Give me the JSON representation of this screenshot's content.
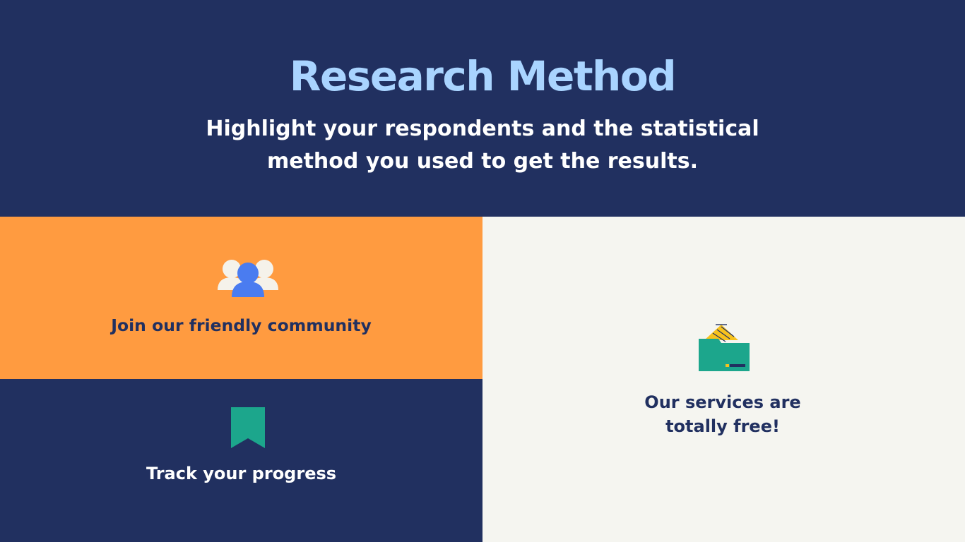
{
  "header": {
    "title": "Research Method",
    "subtitle": "Highlight your respondents and the statistical method you used to get the results."
  },
  "features": [
    {
      "label": "Join our friendly community",
      "icon": "users-icon"
    },
    {
      "label": "Track your progress",
      "icon": "bookmark-icon"
    },
    {
      "label": "Our services are totally free!",
      "icon": "wallet-icon"
    }
  ],
  "colors": {
    "navy": "#213060",
    "title_blue": "#a9d4ff",
    "orange": "#ff9b40",
    "cream": "#f5f5f0",
    "teal": "#1ca68c",
    "user_blue": "#4a7cf0",
    "yellow": "#f7c21d"
  }
}
